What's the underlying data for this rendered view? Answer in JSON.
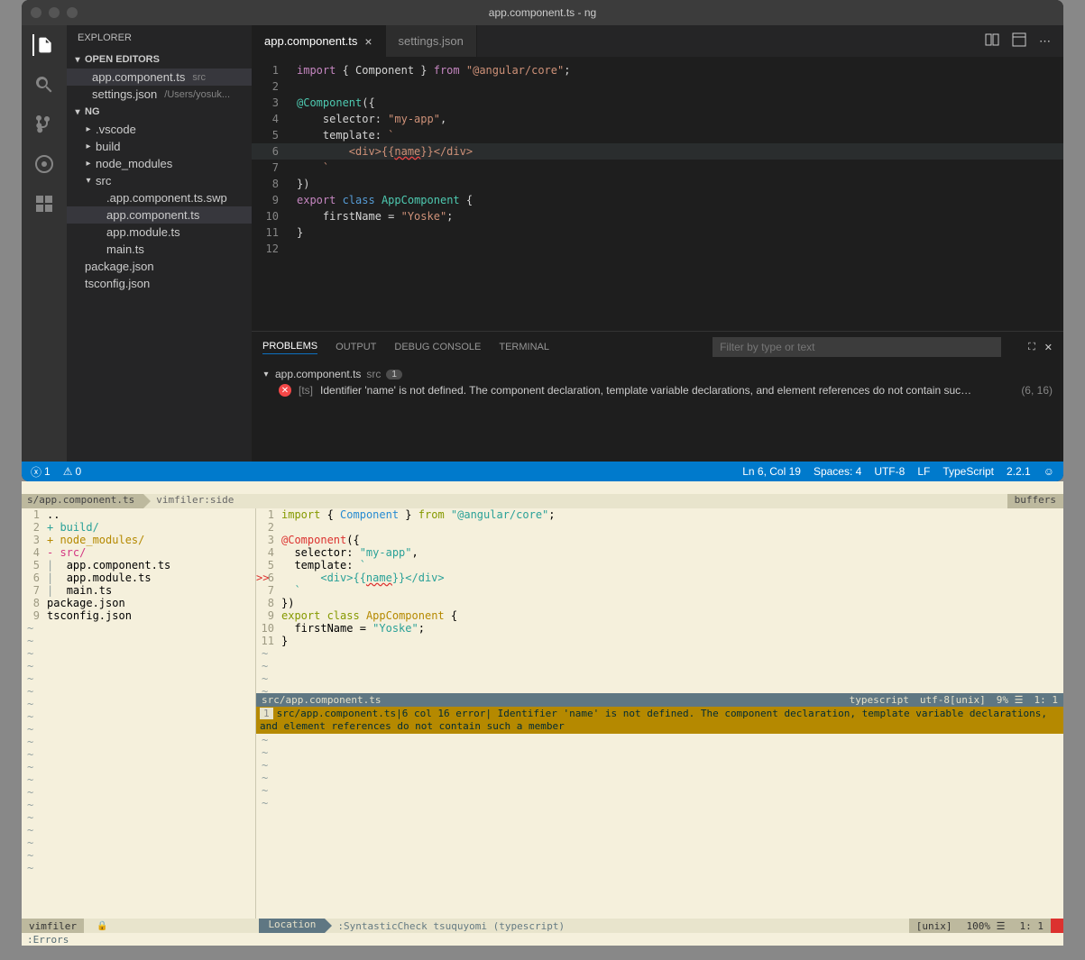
{
  "titlebar": {
    "title": "app.component.ts - ng"
  },
  "sidebar": {
    "header": "EXPLORER",
    "openEditors": {
      "label": "OPEN EDITORS"
    },
    "project": {
      "label": "NG"
    },
    "editors": [
      {
        "name": "app.component.ts",
        "meta": "src"
      },
      {
        "name": "settings.json",
        "meta": "/Users/yosuk..."
      }
    ],
    "tree": {
      "vscode": ".vscode",
      "build": "build",
      "node_modules": "node_modules",
      "src": "src",
      "swp": ".app.component.ts.swp",
      "appcomp": "app.component.ts",
      "appmod": "app.module.ts",
      "main": "main.ts",
      "pkg": "package.json",
      "tsconfig": "tsconfig.json"
    }
  },
  "tabs": [
    {
      "label": "app.component.ts",
      "active": true
    },
    {
      "label": "settings.json",
      "active": false
    }
  ],
  "code": {
    "l1a": "import",
    "l1b": " { Component } ",
    "l1c": "from",
    "l1d": " \"@angular/core\"",
    "l1e": ";",
    "l3a": "@Component",
    "l3b": "({",
    "l4a": "    selector: ",
    "l4b": "\"my-app\"",
    "l4c": ",",
    "l5a": "    template: ",
    "l5b": "`",
    "l6a": "        <div>{{",
    "l6b": "name",
    "l6c": "}}</div>",
    "l7a": "    `",
    "l8a": "})",
    "l9a": "export",
    "l9b": " class",
    "l9c": " AppComponent ",
    "l9d": "{",
    "l10a": "    firstName = ",
    "l10b": "\"Yoske\"",
    "l10c": ";",
    "l11a": "}"
  },
  "panel": {
    "tabs": {
      "problems": "PROBLEMS",
      "output": "OUTPUT",
      "debug": "DEBUG CONSOLE",
      "terminal": "TERMINAL"
    },
    "filter_placeholder": "Filter by type or text",
    "file": "app.component.ts",
    "file_meta": "src",
    "count": "1",
    "source": "[ts]",
    "message": "Identifier 'name' is not defined. The component declaration, template variable declarations, and element references do not contain suc…",
    "location": "(6, 16)"
  },
  "statusbar": {
    "errors": "1",
    "warnings": "0",
    "ln_col": "Ln 6, Col 19",
    "spaces": "Spaces: 4",
    "encoding": "UTF-8",
    "eol": "LF",
    "lang": "TypeScript",
    "version": "2.2.1"
  },
  "vim": {
    "crumb1": "s/app.component.ts",
    "crumb2": "vimfiler:side",
    "buffers": "buffers",
    "filer": {
      "l1": "..",
      "l2p": "+ ",
      "l2": "build/",
      "l3p": "+ ",
      "l3": "node_modules/",
      "l4p": "- ",
      "l4": "src/",
      "l5": "app.component.ts",
      "l6": "app.module.ts",
      "l7": "main.ts",
      "l8": "package.json",
      "l9": "tsconfig.json"
    },
    "code": {
      "l1a": "import",
      "l1b": " { ",
      "l1c": "Component",
      "l1d": " } ",
      "l1e": "from",
      "l1f": " \"@angular/core\"",
      "l1g": ";",
      "l3a": "@Component",
      "l3b": "({",
      "l4a": "  selector: ",
      "l4b": "\"my-app\"",
      "l4c": ",",
      "l5a": "  template: ",
      "l5b": "`",
      "l6a": "      <div>{{",
      "l6b": "name",
      "l6c": "}}</div>",
      "l7a": "  `",
      "l8a": "})",
      "l9a": "export",
      "l9b": " class",
      "l9c": " AppComponent",
      "l9d": " {",
      "l10a": "  firstName ",
      "l10b": "=",
      "l10c": " \"Yoske\"",
      "l10d": ";",
      "l11a": "}"
    },
    "status": {
      "path": "src/app.component.ts",
      "ft": "typescript",
      "enc": "utf-8[unix]",
      "pct": "9% ☰",
      "pos": "1:  1"
    },
    "error": {
      "ln": "1",
      "text": "src/app.component.ts|6 col 16 error| Identifier 'name' is not defined. The component declaration, template variable declarations, and element references do not contain such a member"
    },
    "bottom": {
      "left_mode": "vimfiler",
      "location": "Location",
      "cmd": ":SyntasticCheck tsuquyomi (typescript)",
      "unix": "[unix]",
      "pct": "100% ☰",
      "pos": "1:  1"
    },
    "cmdline": ":Errors"
  }
}
